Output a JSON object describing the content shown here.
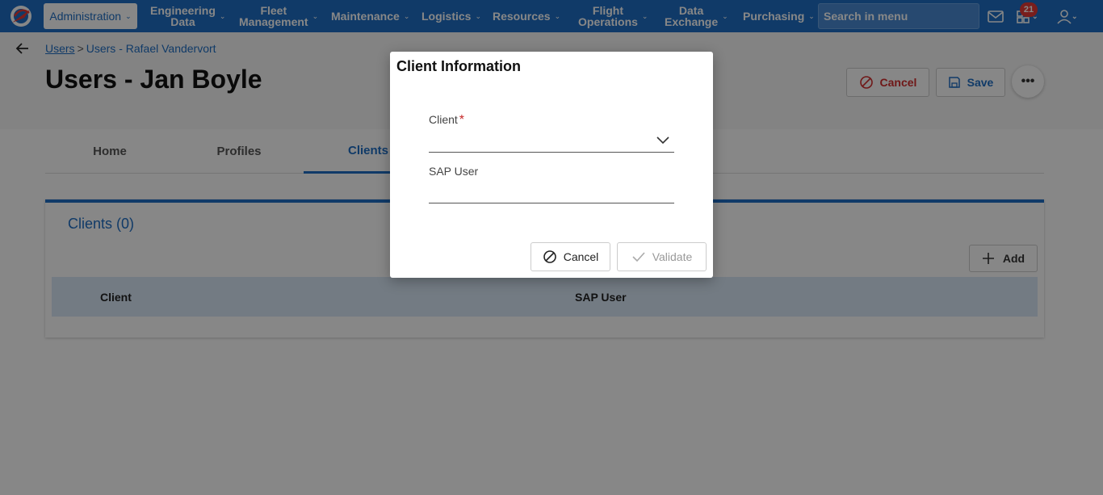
{
  "nav": {
    "items": [
      {
        "label": "Administration"
      },
      {
        "label_line1": "Engineering",
        "label_line2": "Data"
      },
      {
        "label_line1": "Fleet",
        "label_line2": "Management"
      },
      {
        "label": "Maintenance"
      },
      {
        "label": "Logistics"
      },
      {
        "label": "Resources"
      },
      {
        "label_line1": "Flight",
        "label_line2": "Operations"
      },
      {
        "label_line1": "Data",
        "label_line2": "Exchange"
      },
      {
        "label": "Purchasing"
      }
    ],
    "search_placeholder": "Search in menu",
    "notification_count": "21"
  },
  "breadcrumb": {
    "link": "Users",
    "separator": ">",
    "current": "Users - Rafael Vandervort"
  },
  "page": {
    "title": "Users - Jan Boyle",
    "cancel_label": "Cancel",
    "save_label": "Save",
    "more_label": "•••"
  },
  "tabs": [
    {
      "label": "Home"
    },
    {
      "label": "Profiles"
    },
    {
      "label": "Clients"
    }
  ],
  "clients_panel": {
    "title": "Clients (0)",
    "add_label": "Add",
    "columns": [
      "Client",
      "SAP User"
    ]
  },
  "dialog": {
    "title": "Client Information",
    "client_label": "Client",
    "required_mark": "*",
    "sap_user_label": "SAP User",
    "cancel_label": "Cancel",
    "validate_label": "Validate"
  },
  "colors": {
    "brand_blue": "#1f6fc4",
    "danger_red": "#d32f2f",
    "badge_red": "#e53935"
  }
}
